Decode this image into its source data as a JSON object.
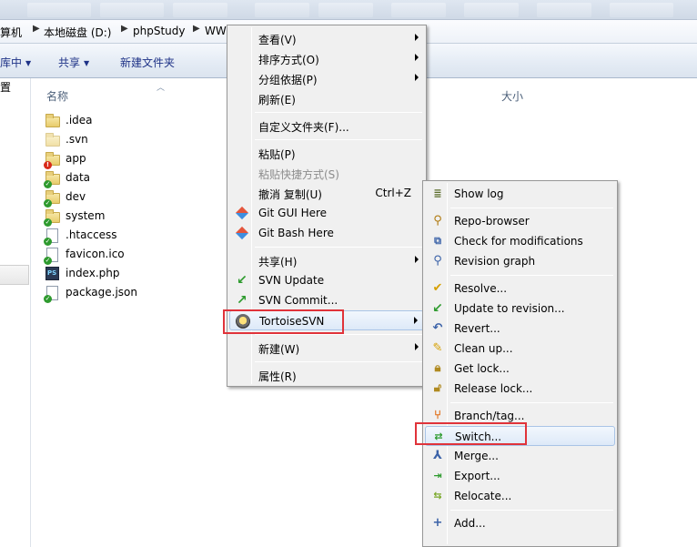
{
  "breadcrumb": {
    "items": [
      "算机",
      "本地磁盘 (D:)",
      "phpStudy",
      "WW"
    ]
  },
  "toolbar": {
    "library_label": "库中",
    "share_label": "共享",
    "new_folder_label": "新建文件夹"
  },
  "nav": {
    "partial_text": "置"
  },
  "file_list": {
    "col_name": "名称",
    "col_size": "大小",
    "files": [
      {
        "name": ".idea",
        "type": "folder",
        "status": "none"
      },
      {
        "name": ".svn",
        "type": "folder",
        "status": "none"
      },
      {
        "name": "app",
        "type": "folder",
        "status": "modified"
      },
      {
        "name": "data",
        "type": "folder",
        "status": "ok"
      },
      {
        "name": "dev",
        "type": "folder",
        "status": "ok"
      },
      {
        "name": "system",
        "type": "folder",
        "status": "ok"
      },
      {
        "name": ".htaccess",
        "type": "file",
        "status": "ok"
      },
      {
        "name": "favicon.ico",
        "type": "file",
        "status": "ok"
      },
      {
        "name": "index.php",
        "type": "php",
        "status": "none"
      },
      {
        "name": "package.json",
        "type": "file",
        "status": "ok"
      }
    ]
  },
  "context_menu": {
    "items": [
      {
        "label": "查看(V)",
        "submenu": true
      },
      {
        "label": "排序方式(O)",
        "submenu": true
      },
      {
        "label": "分组依据(P)",
        "submenu": true
      },
      {
        "label": "刷新(E)"
      },
      {
        "label": "自定义文件夹(F)..."
      },
      {
        "label": "粘贴(P)"
      },
      {
        "label": "粘贴快捷方式(S)",
        "disabled": true
      },
      {
        "label": "撤消 复制(U)",
        "shortcut": "Ctrl+Z"
      },
      {
        "label": "Git GUI Here",
        "icon": "git-gui-icon"
      },
      {
        "label": "Git Bash Here",
        "icon": "git-bash-icon"
      },
      {
        "label": "共享(H)",
        "submenu": true
      },
      {
        "label": "SVN Update",
        "icon": "svn-update-icon"
      },
      {
        "label": "SVN Commit...",
        "icon": "svn-commit-icon"
      },
      {
        "label": "TortoiseSVN",
        "submenu": true,
        "icon": "tortoisesvn-icon"
      },
      {
        "label": "新建(W)",
        "submenu": true
      },
      {
        "label": "属性(R)"
      }
    ]
  },
  "svn_submenu": {
    "items": [
      {
        "label": "Show log",
        "icon": "show-log-icon"
      },
      {
        "label": "Repo-browser",
        "icon": "repo-browser-icon"
      },
      {
        "label": "Check for modifications",
        "icon": "check-modifications-icon"
      },
      {
        "label": "Revision graph",
        "icon": "revision-graph-icon"
      },
      {
        "label": "Resolve...",
        "icon": "resolve-icon"
      },
      {
        "label": "Update to revision...",
        "icon": "update-revision-icon"
      },
      {
        "label": "Revert...",
        "icon": "revert-icon"
      },
      {
        "label": "Clean up...",
        "icon": "cleanup-icon"
      },
      {
        "label": "Get lock...",
        "icon": "get-lock-icon"
      },
      {
        "label": "Release lock...",
        "icon": "release-lock-icon"
      },
      {
        "label": "Branch/tag...",
        "icon": "branch-tag-icon"
      },
      {
        "label": "Switch...",
        "icon": "switch-icon"
      },
      {
        "label": "Merge...",
        "icon": "merge-icon"
      },
      {
        "label": "Export...",
        "icon": "export-icon"
      },
      {
        "label": "Relocate...",
        "icon": "relocate-icon"
      },
      {
        "label": "Add...",
        "icon": "add-icon"
      }
    ]
  },
  "colors": {
    "highlight_box": "#e0333a",
    "menu_bg": "#f0f0f0",
    "toolbar_text": "#1e3287"
  }
}
